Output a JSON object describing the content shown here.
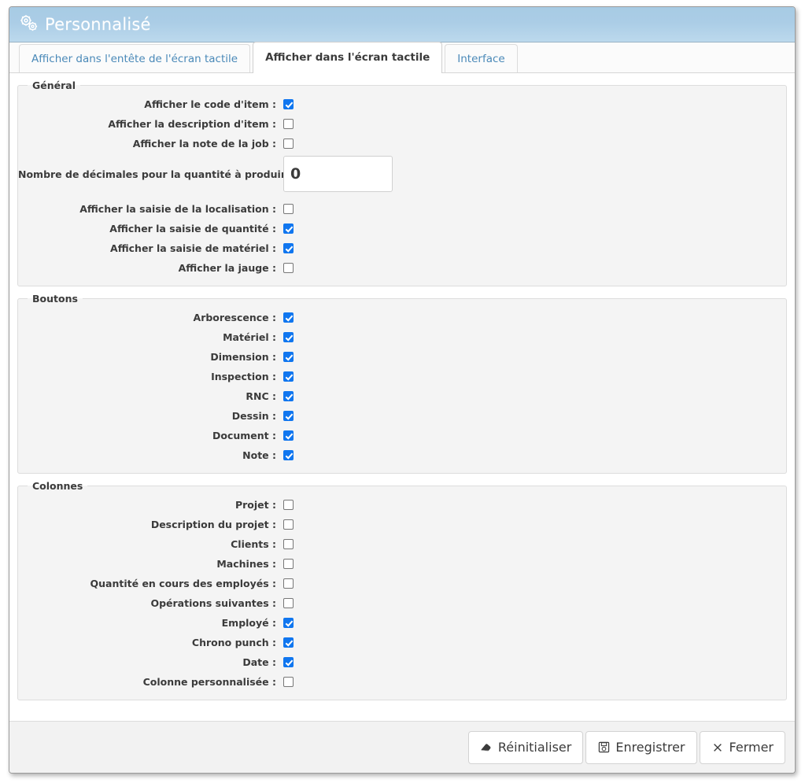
{
  "window": {
    "title": "Personnalisé",
    "icon": "gears-icon"
  },
  "tabs": [
    {
      "label": "Afficher dans l'entête de l'écran tactile",
      "active": false
    },
    {
      "label": "Afficher dans l'écran tactile",
      "active": true
    },
    {
      "label": "Interface",
      "active": false
    }
  ],
  "sections": [
    {
      "legend": "Général",
      "rows": [
        {
          "label": "Afficher le code d'item :",
          "type": "checkbox",
          "checked": true,
          "name": "show-item-code"
        },
        {
          "label": "Afficher la description d'item :",
          "type": "checkbox",
          "checked": false,
          "name": "show-item-description"
        },
        {
          "label": "Afficher la note de la job :",
          "type": "checkbox",
          "checked": false,
          "name": "show-job-note"
        },
        {
          "label": "Nombre de décimales pour la quantité à produire :",
          "type": "number",
          "value": "0",
          "name": "decimals-quantity-to-produce"
        },
        {
          "label": "Afficher la saisie de la localisation :",
          "type": "checkbox",
          "checked": false,
          "name": "show-location-entry"
        },
        {
          "label": "Afficher la saisie de quantité :",
          "type": "checkbox",
          "checked": true,
          "name": "show-quantity-entry"
        },
        {
          "label": "Afficher la saisie de matériel :",
          "type": "checkbox",
          "checked": true,
          "name": "show-material-entry"
        },
        {
          "label": "Afficher la jauge :",
          "type": "checkbox",
          "checked": false,
          "name": "show-gauge"
        }
      ]
    },
    {
      "legend": "Boutons",
      "rows": [
        {
          "label": "Arborescence :",
          "type": "checkbox",
          "checked": true,
          "name": "button-tree"
        },
        {
          "label": "Matériel :",
          "type": "checkbox",
          "checked": true,
          "name": "button-material"
        },
        {
          "label": "Dimension :",
          "type": "checkbox",
          "checked": true,
          "name": "button-dimension"
        },
        {
          "label": "Inspection :",
          "type": "checkbox",
          "checked": true,
          "name": "button-inspection"
        },
        {
          "label": "RNC :",
          "type": "checkbox",
          "checked": true,
          "name": "button-rnc"
        },
        {
          "label": "Dessin :",
          "type": "checkbox",
          "checked": true,
          "name": "button-drawing"
        },
        {
          "label": "Document :",
          "type": "checkbox",
          "checked": true,
          "name": "button-document"
        },
        {
          "label": "Note :",
          "type": "checkbox",
          "checked": true,
          "name": "button-note"
        }
      ]
    },
    {
      "legend": "Colonnes",
      "rows": [
        {
          "label": "Projet :",
          "type": "checkbox",
          "checked": false,
          "name": "column-project"
        },
        {
          "label": "Description du projet :",
          "type": "checkbox",
          "checked": false,
          "name": "column-project-description"
        },
        {
          "label": "Clients :",
          "type": "checkbox",
          "checked": false,
          "name": "column-clients"
        },
        {
          "label": "Machines :",
          "type": "checkbox",
          "checked": false,
          "name": "column-machines"
        },
        {
          "label": "Quantité en cours des employés :",
          "type": "checkbox",
          "checked": false,
          "name": "column-employee-wip-quantity"
        },
        {
          "label": "Opérations suivantes :",
          "type": "checkbox",
          "checked": false,
          "name": "column-next-operations"
        },
        {
          "label": "Employé :",
          "type": "checkbox",
          "checked": true,
          "name": "column-employee"
        },
        {
          "label": "Chrono punch :",
          "type": "checkbox",
          "checked": true,
          "name": "column-chrono-punch"
        },
        {
          "label": "Date :",
          "type": "checkbox",
          "checked": true,
          "name": "column-date"
        },
        {
          "label": "Colonne personnalisée :",
          "type": "checkbox",
          "checked": false,
          "name": "column-custom"
        }
      ]
    }
  ],
  "footer": {
    "buttons": [
      {
        "label": "Réinitialiser",
        "icon": "eraser-icon",
        "name": "reset-button"
      },
      {
        "label": "Enregistrer",
        "icon": "floppy-disk-icon",
        "name": "save-button"
      },
      {
        "label": "Fermer",
        "icon": "close-x-icon",
        "name": "close-button"
      }
    ]
  },
  "colors": {
    "titlebar_top": "#a7cbe4",
    "titlebar_bottom": "#bcd9ed",
    "checkbox_checked": "#1076ef",
    "tab_inactive_text": "#4a89b8",
    "section_bg": "#f4f4f4"
  }
}
